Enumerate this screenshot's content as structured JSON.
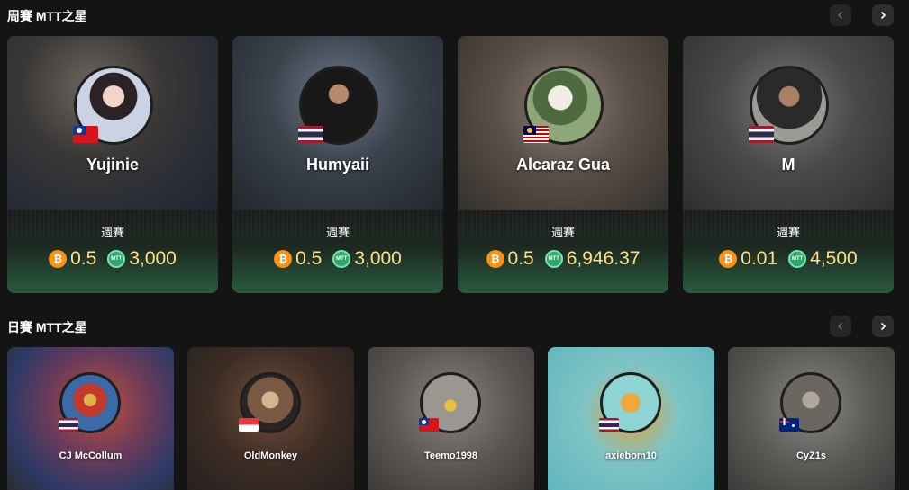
{
  "weekly": {
    "title": "周賽 MTT之星",
    "cards": [
      {
        "name": "Yujinie",
        "event": "週賽",
        "btc": "0.5",
        "mtt": "3,000",
        "flag": "TW"
      },
      {
        "name": "Humyaii",
        "event": "週賽",
        "btc": "0.5",
        "mtt": "3,000",
        "flag": "TH"
      },
      {
        "name": "Alcaraz Gua",
        "event": "週賽",
        "btc": "0.5",
        "mtt": "6,946.37",
        "flag": "MY"
      },
      {
        "name": "M",
        "event": "週賽",
        "btc": "0.01",
        "mtt": "4,500",
        "flag": "TH"
      }
    ]
  },
  "daily": {
    "title": "日賽 MTT之星",
    "cards": [
      {
        "name": "CJ McCollum",
        "flag": "TH"
      },
      {
        "name": "OldMonkey",
        "flag": "SG"
      },
      {
        "name": "Teemo1998",
        "flag": "TW"
      },
      {
        "name": "axiebom10",
        "flag": "TH"
      },
      {
        "name": "CyZ1s",
        "flag": "AU"
      }
    ]
  },
  "icons": {
    "prev": "chevron-left-icon",
    "next": "chevron-right-icon",
    "btc": "btc-coin-icon",
    "mtt": "mtt-coin-icon"
  },
  "coin_labels": {
    "btc": "₿",
    "mtt": "MTT"
  },
  "colors": {
    "background": "#141414",
    "prize_text": "#ffe08a",
    "btc_coin": "#f6921a",
    "mtt_coin": "#2fa66c"
  }
}
